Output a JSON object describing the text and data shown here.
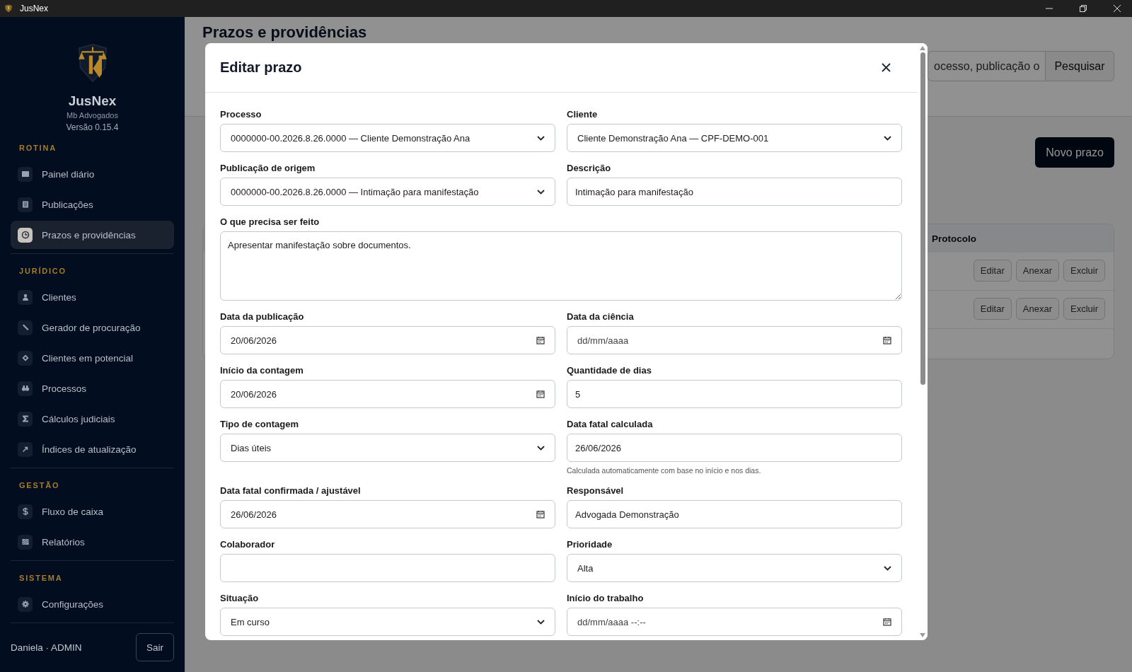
{
  "window": {
    "title": "JusNex"
  },
  "sidebar": {
    "brand": "JusNex",
    "firm": "Mb Advogados",
    "version": "Versão 0.15.4",
    "sections": [
      {
        "title": "ROTINA",
        "items": [
          {
            "label": "Painel diário",
            "selected": false
          },
          {
            "label": "Publicações",
            "selected": false
          },
          {
            "label": "Prazos e providências",
            "selected": true
          }
        ]
      },
      {
        "title": "JURÍDICO",
        "items": [
          {
            "label": "Clientes",
            "selected": false
          },
          {
            "label": "Gerador de procuração",
            "selected": false
          },
          {
            "label": "Clientes em potencial",
            "selected": false
          },
          {
            "label": "Processos",
            "selected": false
          },
          {
            "label": "Cálculos judiciais",
            "selected": false
          },
          {
            "label": "Índices de atualização",
            "selected": false
          }
        ]
      },
      {
        "title": "GESTÃO",
        "items": [
          {
            "label": "Fluxo de caixa",
            "selected": false
          },
          {
            "label": "Relatórios",
            "selected": false
          }
        ]
      },
      {
        "title": "SISTEMA",
        "items": [
          {
            "label": "Configurações",
            "selected": false
          }
        ]
      }
    ],
    "user": "Daniela · ADMIN",
    "logout": "Sair"
  },
  "page": {
    "title": "Prazos e providências",
    "search": {
      "value": "ocesso, publicação o"
    },
    "search_button": "Pesquisar",
    "new_button": "Novo prazo",
    "table": {
      "columns": [
        "Protocolo"
      ],
      "rows": [
        {
          "actions": [
            "Editar",
            "Anexar",
            "Excluir"
          ]
        },
        {
          "actions": [
            "Editar",
            "Anexar",
            "Excluir"
          ]
        }
      ]
    }
  },
  "modal": {
    "title": "Editar prazo",
    "fields": [
      {
        "label": "Processo",
        "kind": "select",
        "value": "0000000-00.2026.8.26.0000 — Cliente Demonstração Ana"
      },
      {
        "label": "Cliente",
        "kind": "select",
        "value": "Cliente Demonstração Ana — CPF-DEMO-001"
      },
      {
        "label": "Publicação de origem",
        "kind": "select",
        "value": "0000000-00.2026.8.26.0000 — Intimação para manifestação"
      },
      {
        "label": "Descrição",
        "kind": "text",
        "value": "Intimação para manifestação"
      },
      {
        "label": "O que precisa ser feito",
        "kind": "textarea",
        "value": "Apresentar manifestação sobre documentos."
      },
      {
        "label": "Data da publicação",
        "kind": "date",
        "value": "20/06/2026"
      },
      {
        "label": "Data da ciência",
        "kind": "date",
        "placeholder": "dd/mm/aaaa"
      },
      {
        "label": "Início da contagem",
        "kind": "date",
        "value": "20/06/2026"
      },
      {
        "label": "Quantidade de dias",
        "kind": "text",
        "value": "5"
      },
      {
        "label": "Tipo de contagem",
        "kind": "select",
        "value": "Dias úteis"
      },
      {
        "label": "Data fatal calculada",
        "kind": "text",
        "value": "26/06/2026",
        "hint": "Calculada automaticamente com base no início e nos dias."
      },
      {
        "label": "Data fatal confirmada / ajustável",
        "kind": "date",
        "value": "26/06/2026"
      },
      {
        "label": "Responsável",
        "kind": "text",
        "value": "Advogada Demonstração"
      },
      {
        "label": "Colaborador",
        "kind": "text"
      },
      {
        "label": "Prioridade",
        "kind": "select",
        "value": "Alta"
      },
      {
        "label": "Situação",
        "kind": "select",
        "value": "Em curso"
      },
      {
        "label": "Início do trabalho",
        "kind": "date",
        "placeholder": "dd/mm/aaaa --:--"
      }
    ]
  }
}
